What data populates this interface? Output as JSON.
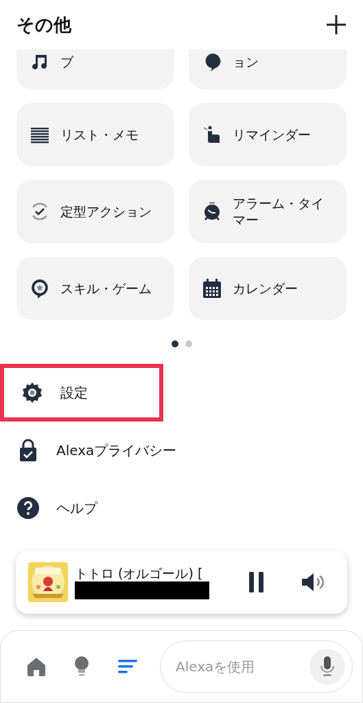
{
  "header": {
    "title": "その他"
  },
  "tiles": [
    {
      "kind": "music",
      "label": "ブ",
      "clipped": true
    },
    {
      "kind": "chat",
      "label": "ョン",
      "clipped": true
    },
    {
      "kind": "list",
      "label": "リスト・メモ",
      "clipped": false
    },
    {
      "kind": "reminder",
      "label": "リマインダー",
      "clipped": false
    },
    {
      "kind": "routine",
      "label": "定型アクション",
      "clipped": false
    },
    {
      "kind": "alarm",
      "label": "アラーム・タイマー",
      "clipped": false
    },
    {
      "kind": "skill",
      "label": "スキル・ゲーム",
      "clipped": false
    },
    {
      "kind": "calendar",
      "label": "カレンダー",
      "clipped": false
    }
  ],
  "pages": [
    {
      "selected": true
    },
    {
      "selected": false
    }
  ],
  "menu": [
    {
      "kind": "settings",
      "label": "設定",
      "highlighted": true
    },
    {
      "kind": "privacy",
      "label": "Alexaプライバシー",
      "highlighted": false
    },
    {
      "kind": "help",
      "label": "ヘルプ",
      "highlighted": false
    }
  ],
  "now_playing": {
    "title": "トトロ (オルゴール) [",
    "playing": true
  },
  "nav": [
    {
      "kind": "home",
      "selected": false
    },
    {
      "kind": "bulb",
      "selected": false
    },
    {
      "kind": "more",
      "selected": true
    }
  ],
  "search": {
    "placeholder": "Alexaを使用"
  }
}
